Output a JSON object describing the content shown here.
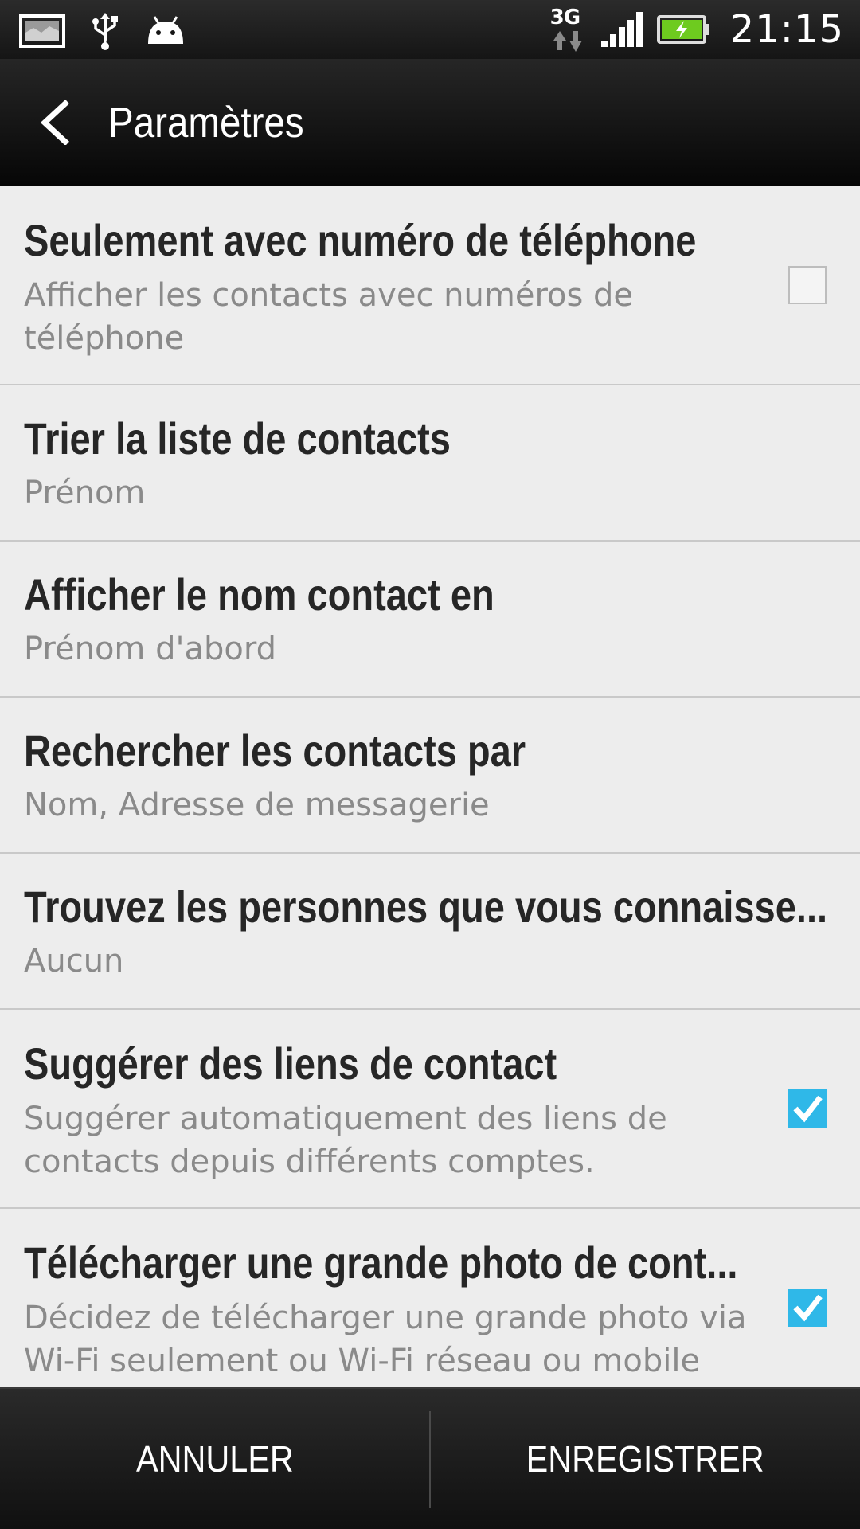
{
  "status_bar": {
    "time": "21:15",
    "network_type": "3G",
    "battery_color": "#6ecb1f",
    "icons": [
      "screenshot-icon",
      "usb-icon",
      "android-debug-icon",
      "data-arrows-icon",
      "signal-icon",
      "battery-charging-icon"
    ]
  },
  "header": {
    "title": "Paramètres",
    "back_icon": "chevron-left-icon"
  },
  "settings": [
    {
      "title": "Seulement avec numéro de téléphone",
      "summary": "Afficher les contacts avec numéros de téléphone",
      "checkbox": "unchecked"
    },
    {
      "title": "Trier la liste de contacts",
      "summary": "Prénom"
    },
    {
      "title": "Afficher le nom contact en",
      "summary": "Prénom d'abord"
    },
    {
      "title": "Rechercher les contacts par",
      "summary": "Nom, Adresse de messagerie"
    },
    {
      "title": "Trouvez les personnes que vous connaisse...",
      "summary": "Aucun"
    },
    {
      "title": "Suggérer des liens de contact",
      "summary": "Suggérer automatiquement des liens de contacts depuis différents comptes.",
      "checkbox": "checked"
    },
    {
      "title": "Télécharger une grande photo de cont...",
      "summary": "Décidez de télécharger une grande photo via Wi-Fi seulement ou Wi-Fi réseau ou mobile",
      "checkbox": "checked"
    }
  ],
  "checkbox_color": "#2fb8e8",
  "bottom_bar": {
    "cancel_label": "ANNULER",
    "save_label": "ENREGISTRER"
  }
}
